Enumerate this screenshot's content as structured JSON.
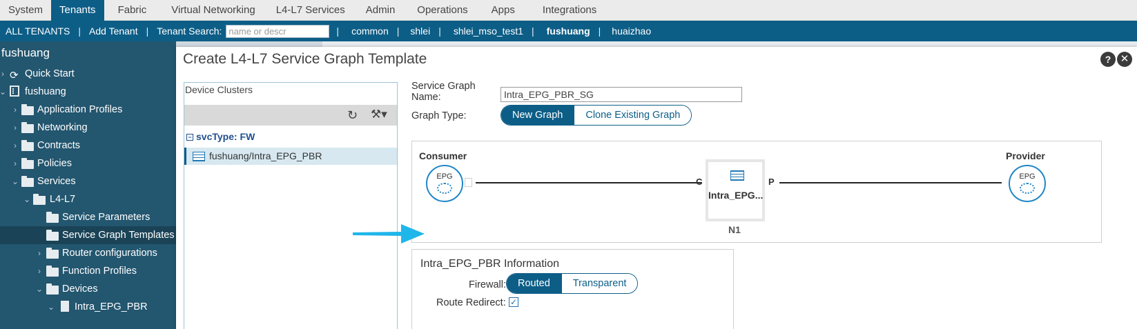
{
  "top_menu": {
    "tabs": [
      "System",
      "Tenants",
      "Fabric",
      "Virtual Networking",
      "L4-L7 Services",
      "Admin",
      "Operations",
      "Apps",
      "Integrations"
    ],
    "active": "Tenants"
  },
  "tenant_bar": {
    "all_tenants": "ALL TENANTS",
    "add_tenant": "Add Tenant",
    "search_label": "Tenant Search:",
    "search_placeholder": "name or descr",
    "tenants": [
      "common",
      "shlei",
      "shlei_mso_test1",
      "fushuang",
      "huaizhao"
    ],
    "active_tenant": "fushuang"
  },
  "left_nav": {
    "title": "fushuang",
    "items": [
      {
        "label": "Quick Start",
        "icon": "quick-start-icon"
      },
      {
        "label": "fushuang",
        "icon": "building-icon"
      },
      {
        "label": "Application Profiles",
        "icon": "folder-icon"
      },
      {
        "label": "Networking",
        "icon": "folder-icon"
      },
      {
        "label": "Contracts",
        "icon": "folder-icon"
      },
      {
        "label": "Policies",
        "icon": "folder-icon"
      },
      {
        "label": "Services",
        "icon": "folder-icon"
      },
      {
        "label": "L4-L7",
        "icon": "folder-icon"
      },
      {
        "label": "Service Parameters",
        "icon": "folder-icon"
      },
      {
        "label": "Service Graph Templates",
        "icon": "folder-icon"
      },
      {
        "label": "Router configurations",
        "icon": "folder-icon"
      },
      {
        "label": "Function Profiles",
        "icon": "folder-icon"
      },
      {
        "label": "Devices",
        "icon": "folder-icon"
      },
      {
        "label": "Intra_EPG_PBR",
        "icon": "device-icon"
      }
    ],
    "selected": "Service Graph Templates"
  },
  "dialog": {
    "title": "Create L4-L7 Service Graph Template",
    "help": "?",
    "close": "✕",
    "device_clusters": {
      "title": "Device Clusters",
      "refresh_icon": "↻",
      "tools_icon": "⚒▾",
      "group_label": "svcType: FW",
      "group_toggle": "−",
      "item": "fushuang/Intra_EPG_PBR"
    },
    "form": {
      "name_label": "Service Graph Name:",
      "name_value": "Intra_EPG_PBR_SG",
      "graph_type_label": "Graph Type:",
      "graph_type_options": [
        "New Graph",
        "Clone Existing Graph"
      ],
      "graph_type_selected": "New Graph"
    },
    "graph": {
      "consumer_label": "Consumer",
      "provider_label": "Provider",
      "epg_text": "EPG",
      "node_name": "Intra_EPG...",
      "node_id": "N1",
      "consumer_port": "C",
      "provider_port": "P"
    },
    "info": {
      "title": "Intra_EPG_PBR Information",
      "firewall_label": "Firewall:",
      "firewall_options": [
        "Routed",
        "Transparent"
      ],
      "firewall_selected": "Routed",
      "route_redirect_label": "Route Redirect:",
      "route_redirect_checked": true,
      "check_glyph": "✓"
    }
  },
  "colors": {
    "accent": "#0d5e87",
    "nav_bg": "#23566f",
    "arrow": "#1fb6ea"
  }
}
